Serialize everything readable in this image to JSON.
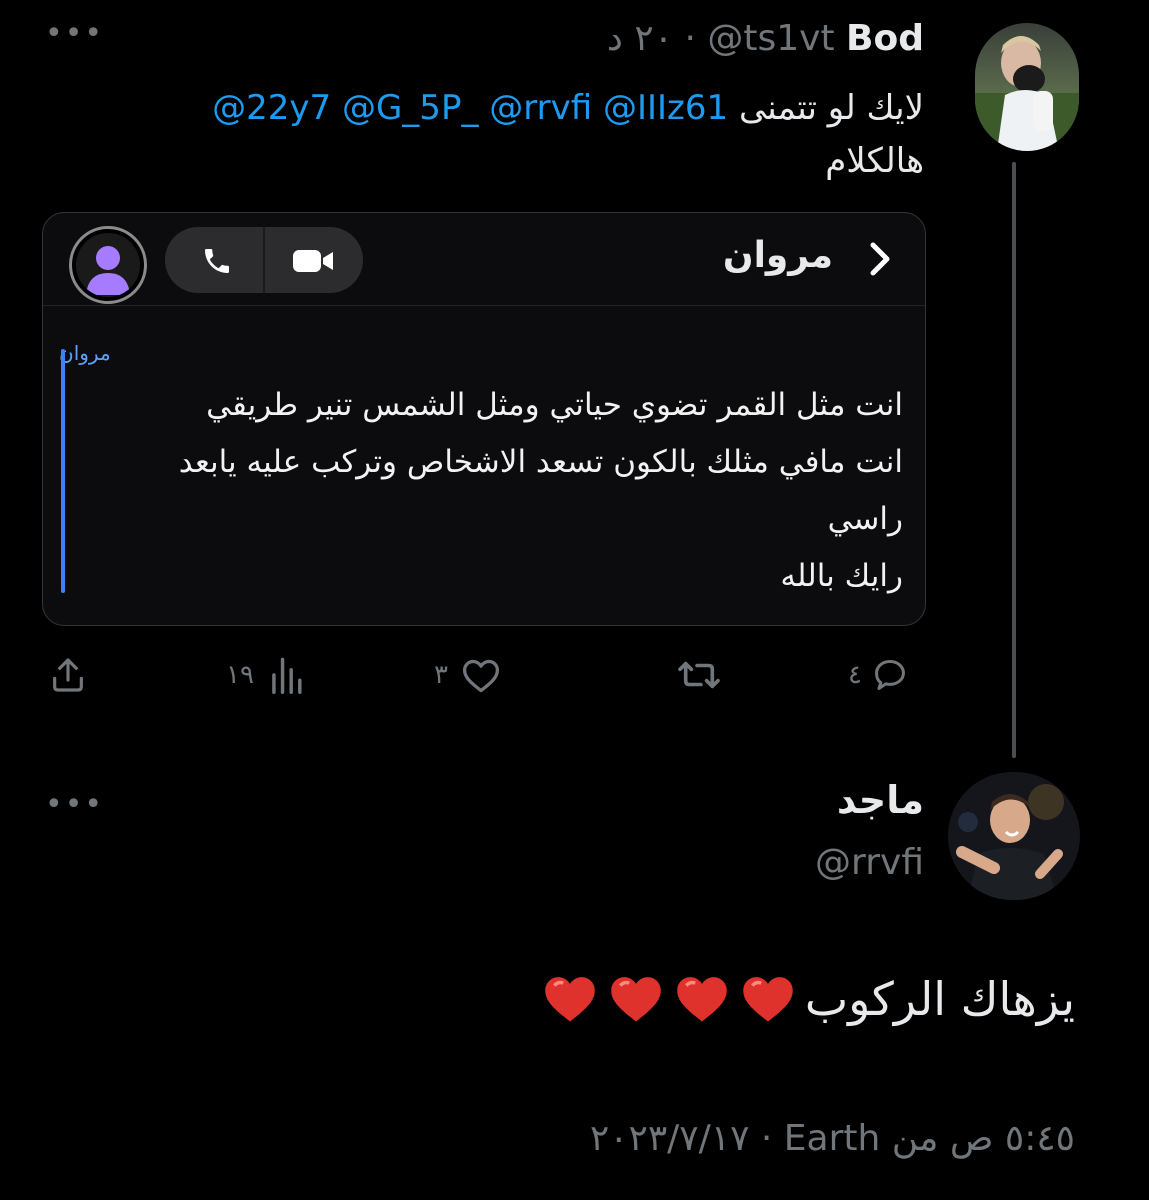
{
  "tweet1": {
    "display_name": "Bod",
    "handle": "@ts1vt",
    "time": "٢٠ د",
    "menu_icon": "more-dots-icon",
    "text_mentions": "@22y7 @G_5P_ @rrvfi @IIIz61",
    "text_before": "لايك لو تتمنى",
    "text_after": "هالكلام",
    "card": {
      "contact_name": "مروان",
      "quote_sender": "مروان",
      "quote_lines": [
        "انت مثل القمر تضوي حياتي ومثل الشمس تنير طريقي",
        "انت مافي مثلك بالكون تسعد الاشخاص وتركب عليه يابعد",
        "راسي",
        "رايك بالله"
      ],
      "icons": [
        "back-chevron-icon",
        "phone-icon",
        "video-icon",
        "contact-avatar-icon"
      ]
    },
    "actions": {
      "replies": "٤",
      "retweets": "",
      "likes": "٣",
      "views": "١٩"
    }
  },
  "tweet2": {
    "display_name": "ماجد",
    "handle": "@rrvfi",
    "text": "يزهاك الركوب",
    "hearts": 4,
    "timestamp": "٥:٤٥ ص من Earth · ٢٠٢٣/٧/١٧"
  },
  "colors": {
    "background": "#000000",
    "link": "#1d9bf0",
    "muted": "#71767b",
    "heart": "#e0322c"
  }
}
